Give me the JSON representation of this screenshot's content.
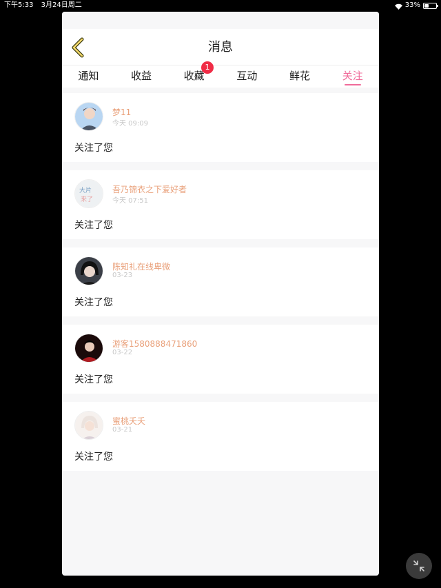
{
  "statusbar": {
    "time": "下午5:33",
    "date": "3月24日周二",
    "battery": "33%",
    "battery_level": 0.33
  },
  "header": {
    "title": "消息",
    "back_icon": "chevron-left-icon"
  },
  "tabs": [
    {
      "label": "通知",
      "active": false
    },
    {
      "label": "收益",
      "active": false
    },
    {
      "label": "收藏",
      "active": false,
      "badge": "1"
    },
    {
      "label": "互动",
      "active": false
    },
    {
      "label": "鲜花",
      "active": false
    },
    {
      "label": "关注",
      "active": true
    }
  ],
  "follows": [
    {
      "name": "梦11",
      "time": "今天 09:09",
      "action": "关注了您"
    },
    {
      "name": "吾乃锦衣之下爱好者",
      "time": "今天 07:51",
      "action": "关注了您"
    },
    {
      "name": "陈知礼在线卑微",
      "time": "03-23",
      "action": "关注了您"
    },
    {
      "name": "游客1580888471860",
      "time": "03-22",
      "action": "关注了您"
    },
    {
      "name": "蜜桃夭夭",
      "time": "03-21",
      "action": "关注了您"
    }
  ],
  "colors": {
    "accent": "#f06b9a",
    "username": "#e9a07a",
    "badge": "#f02c46"
  }
}
